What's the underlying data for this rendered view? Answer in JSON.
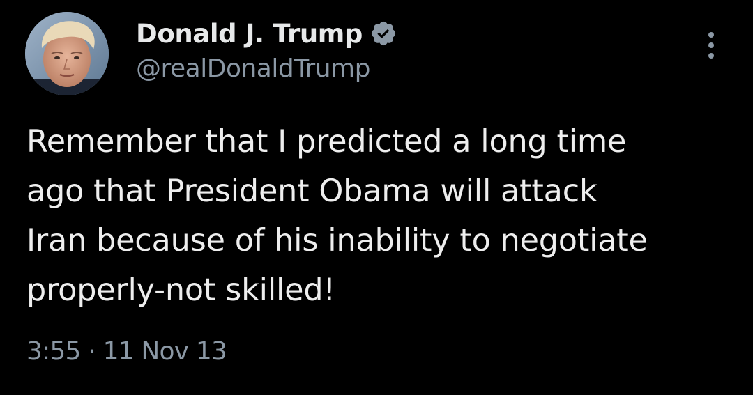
{
  "colors": {
    "background": "#000000",
    "primary_text": "#e7e9ea",
    "secondary_text": "#8b98a5",
    "verified_badge": "#8b98a5"
  },
  "author": {
    "display_name": "Donald J. Trump",
    "handle": "@realDonaldTrump",
    "avatar": "profile-photo",
    "verified_icon": "verified-badge-icon"
  },
  "menu": {
    "icon": "more-options-icon"
  },
  "tweet": {
    "text": "Remember that I predicted a long time\nago that President Obama will attack\nIran because of his inability to negotiate\nproperly-not skilled!",
    "timestamp": "3:55 · 11 Nov 13"
  }
}
